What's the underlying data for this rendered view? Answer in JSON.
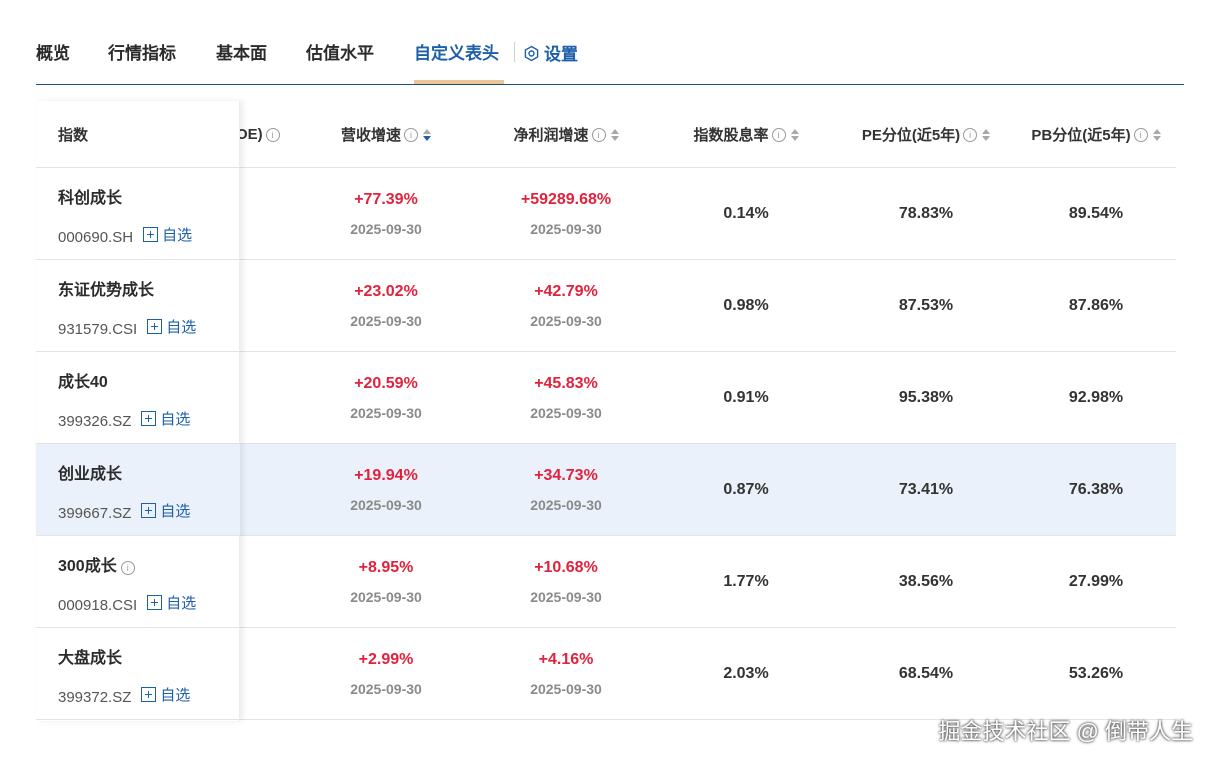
{
  "tabs": [
    {
      "label": "概览"
    },
    {
      "label": "行情指标"
    },
    {
      "label": "基本面"
    },
    {
      "label": "估值水平"
    },
    {
      "label": "自定义表头",
      "active": true
    }
  ],
  "settings_label": "设置",
  "table": {
    "headers": {
      "index": "指数",
      "roe_partial": "OE)",
      "revenue_growth": "营收增速",
      "profit_growth": "净利润增速",
      "dividend_yield": "指数股息率",
      "pe_pct": "PE分位(近5年)",
      "pb_pct": "PB分位(近5年)"
    },
    "info_glyph": "i",
    "add_label": "自选",
    "rows": [
      {
        "name": "科创成长",
        "code": "000690.SH",
        "revenue": "+77.39%",
        "revenue_date": "2025-09-30",
        "profit": "+59289.68%",
        "profit_date": "2025-09-30",
        "dividend": "0.14%",
        "pe": "78.83%",
        "pb": "89.54%"
      },
      {
        "name": "东证优势成长",
        "code": "931579.CSI",
        "revenue": "+23.02%",
        "revenue_date": "2025-09-30",
        "profit": "+42.79%",
        "profit_date": "2025-09-30",
        "dividend": "0.98%",
        "pe": "87.53%",
        "pb": "87.86%"
      },
      {
        "name": "成长40",
        "code": "399326.SZ",
        "revenue": "+20.59%",
        "revenue_date": "2025-09-30",
        "profit": "+45.83%",
        "profit_date": "2025-09-30",
        "dividend": "0.91%",
        "pe": "95.38%",
        "pb": "92.98%"
      },
      {
        "name": "创业成长",
        "code": "399667.SZ",
        "revenue": "+19.94%",
        "revenue_date": "2025-09-30",
        "profit": "+34.73%",
        "profit_date": "2025-09-30",
        "dividend": "0.87%",
        "pe": "73.41%",
        "pb": "76.38%",
        "highlight": true
      },
      {
        "name": "300成长",
        "code": "000918.CSI",
        "revenue": "+8.95%",
        "revenue_date": "2025-09-30",
        "profit": "+10.68%",
        "profit_date": "2025-09-30",
        "dividend": "1.77%",
        "pe": "38.56%",
        "pb": "27.99%",
        "info": true
      },
      {
        "name": "大盘成长",
        "code": "399372.SZ",
        "revenue": "+2.99%",
        "revenue_date": "2025-09-30",
        "profit": "+4.16%",
        "profit_date": "2025-09-30",
        "dividend": "2.03%",
        "pe": "68.54%",
        "pb": "53.26%"
      }
    ]
  },
  "watermark": "掘金技术社区 @ 倒带人生",
  "colors": {
    "accent": "#1d5fa8",
    "positive": "#e0223c",
    "highlight_row": "#eaf1fb",
    "tab_underline": "#e9c79a"
  }
}
